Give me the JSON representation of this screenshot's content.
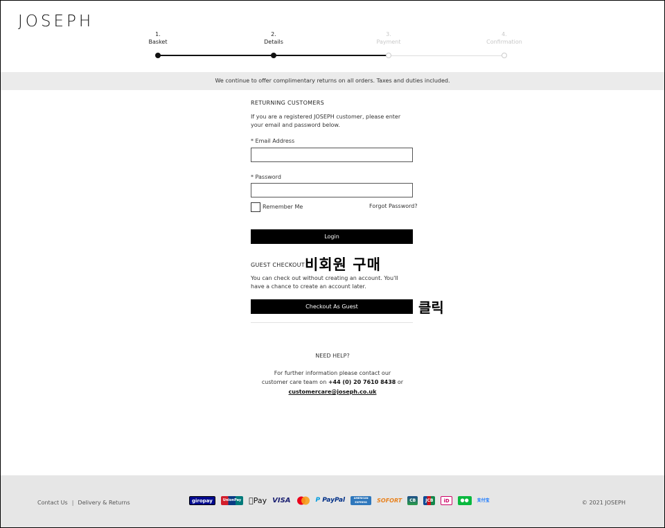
{
  "brand": "JOSEPH",
  "steps": [
    {
      "num": "1.",
      "label": "Basket",
      "state": "done"
    },
    {
      "num": "2.",
      "label": "Details",
      "state": "done"
    },
    {
      "num": "3.",
      "label": "Payment",
      "state": "todo"
    },
    {
      "num": "4.",
      "label": "Confirmation",
      "state": "todo"
    }
  ],
  "banner": "We continue to offer complimentary returns on all orders. Taxes and duties included.",
  "returning": {
    "heading": "RETURNING CUSTOMERS",
    "intro": "If you are a registered JOSEPH customer, please enter your email and password below.",
    "email_label": "* Email Address",
    "email_value": "",
    "password_label": "* Password",
    "password_value": "",
    "remember_label": "Remember Me",
    "forgot_label": "Forgot Password?",
    "login_label": "Login"
  },
  "guest": {
    "heading": "GUEST CHECKOUT",
    "annotation": "비회원 구매",
    "intro": "You can check out without creating an account. You'll have a chance to create an account later.",
    "button_label": "Checkout As Guest",
    "button_annotation": "클릭"
  },
  "help": {
    "heading": "NEED HELP?",
    "line1": "For further information please contact our",
    "line2_prefix": "customer care team on ",
    "phone": "+44 (0) 20 7610 8438",
    "line2_suffix": " or",
    "email": "customercare@joseph.co.uk"
  },
  "footer": {
    "contact": "Contact Us",
    "separator": "|",
    "delivery": "Delivery & Returns",
    "copyright": "© 2021 JOSEPH",
    "payments": [
      {
        "name": "giropay",
        "icon": "giropay-icon"
      },
      {
        "name": "UnionPay",
        "icon": "unionpay-icon"
      },
      {
        "name": "Pay",
        "icon": "apple-pay-icon"
      },
      {
        "name": "VISA",
        "icon": "visa-icon"
      },
      {
        "name": "",
        "icon": "mastercard-icon"
      },
      {
        "name": "PayPal",
        "icon": "paypal-icon"
      },
      {
        "name": "AMERICAN EXPRESS",
        "icon": "amex-icon"
      },
      {
        "name": "SOFORT",
        "icon": "sofort-icon"
      },
      {
        "name": "CB",
        "icon": "cb-icon"
      },
      {
        "name": "JCB",
        "icon": "jcb-icon"
      },
      {
        "name": "iD",
        "icon": "ideal-icon"
      },
      {
        "name": "",
        "icon": "wechat-pay-icon"
      },
      {
        "name": "支付宝",
        "icon": "alipay-icon"
      }
    ]
  }
}
